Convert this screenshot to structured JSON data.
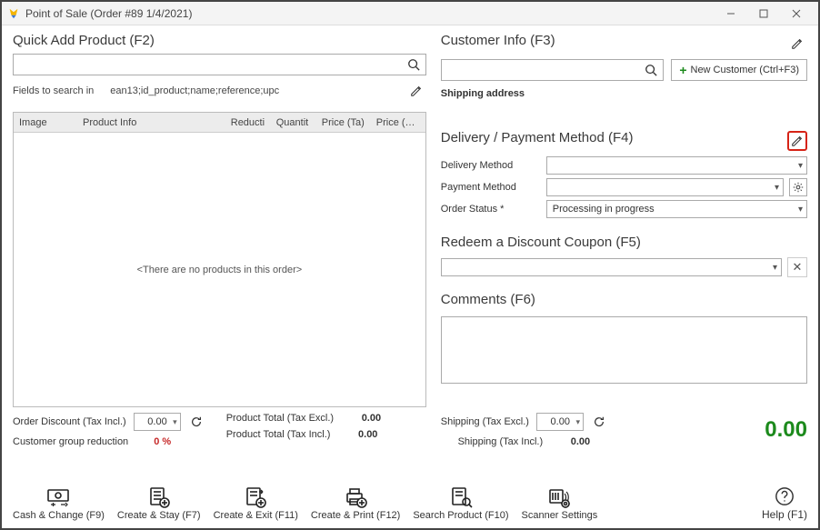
{
  "window": {
    "title": "Point of Sale (Order #89 1/4/2021)"
  },
  "left": {
    "quickadd_title": "Quick Add Product (F2)",
    "search_placeholder": "",
    "fields_label": "Fields to search in",
    "fields_value": "ean13;id_product;name;reference;upc",
    "table": {
      "cols": {
        "image": "Image",
        "info": "Product Info",
        "reduction": "Reducti",
        "qty": "Quantit",
        "ptax": "Price (Ta)",
        "pti": "Price (Tax I"
      },
      "empty_text": "<There are no products in this order>"
    }
  },
  "right": {
    "cust_title": "Customer Info (F3)",
    "new_customer_label": "New Customer (Ctrl+F3)",
    "shipping_addr_label": "Shipping address",
    "delivery_title": "Delivery / Payment Method (F4)",
    "delivery_method_label": "Delivery Method",
    "delivery_method_value": "",
    "payment_method_label": "Payment Method",
    "payment_method_value": "",
    "order_status_label": "Order Status *",
    "order_status_value": "Processing in progress",
    "coupon_title": "Redeem a Discount Coupon (F5)",
    "coupon_value": "",
    "comments_title": "Comments (F6)",
    "comments_value": ""
  },
  "totals": {
    "order_discount_label": "Order Discount (Tax Incl.)",
    "order_discount_value": "0.00",
    "group_reduction_label": "Customer group reduction",
    "group_reduction_value": "0 %",
    "product_total_excl_label": "Product Total (Tax Excl.)",
    "product_total_excl_value": "0.00",
    "product_total_incl_label": "Product Total (Tax Incl.)",
    "product_total_incl_value": "0.00",
    "shipping_excl_label": "Shipping (Tax Excl.)",
    "shipping_excl_value": "0.00",
    "shipping_incl_label": "Shipping (Tax Incl.)",
    "shipping_incl_value": "0.00",
    "grand_total": "0.00"
  },
  "actions": {
    "cash": "Cash & Change (F9)",
    "stay": "Create & Stay (F7)",
    "exit": "Create & Exit (F11)",
    "print": "Create & Print (F12)",
    "search": "Search Product (F10)",
    "scanner": "Scanner Settings",
    "help": "Help (F1)"
  }
}
